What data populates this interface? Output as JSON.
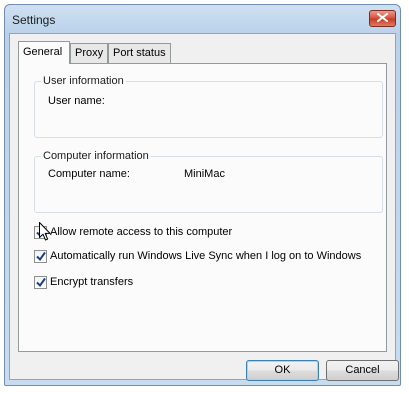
{
  "window": {
    "title": "Settings"
  },
  "tabs": [
    {
      "label": "General",
      "active": true
    },
    {
      "label": "Proxy",
      "active": false
    },
    {
      "label": "Port status",
      "active": false
    }
  ],
  "user_info": {
    "title": "User information",
    "user_name_label": "User name:",
    "user_name_value": ""
  },
  "computer_info": {
    "title": "Computer information",
    "computer_name_label": "Computer name:",
    "computer_name_value": "MiniMac"
  },
  "options": [
    {
      "label": "Allow remote access to this computer",
      "checked": true
    },
    {
      "label": "Automatically run Windows Live Sync when I log on to Windows",
      "checked": true
    },
    {
      "label": "Encrypt transfers",
      "checked": true
    }
  ],
  "buttons": {
    "ok": "OK",
    "cancel": "Cancel"
  },
  "icons": {
    "close": "close-icon",
    "cursor": "mouse-pointer-icon"
  },
  "colors": {
    "close_button": "#d5503b",
    "title_bar": "#b9d1ea",
    "default_button_border": "#3c7fb1"
  }
}
